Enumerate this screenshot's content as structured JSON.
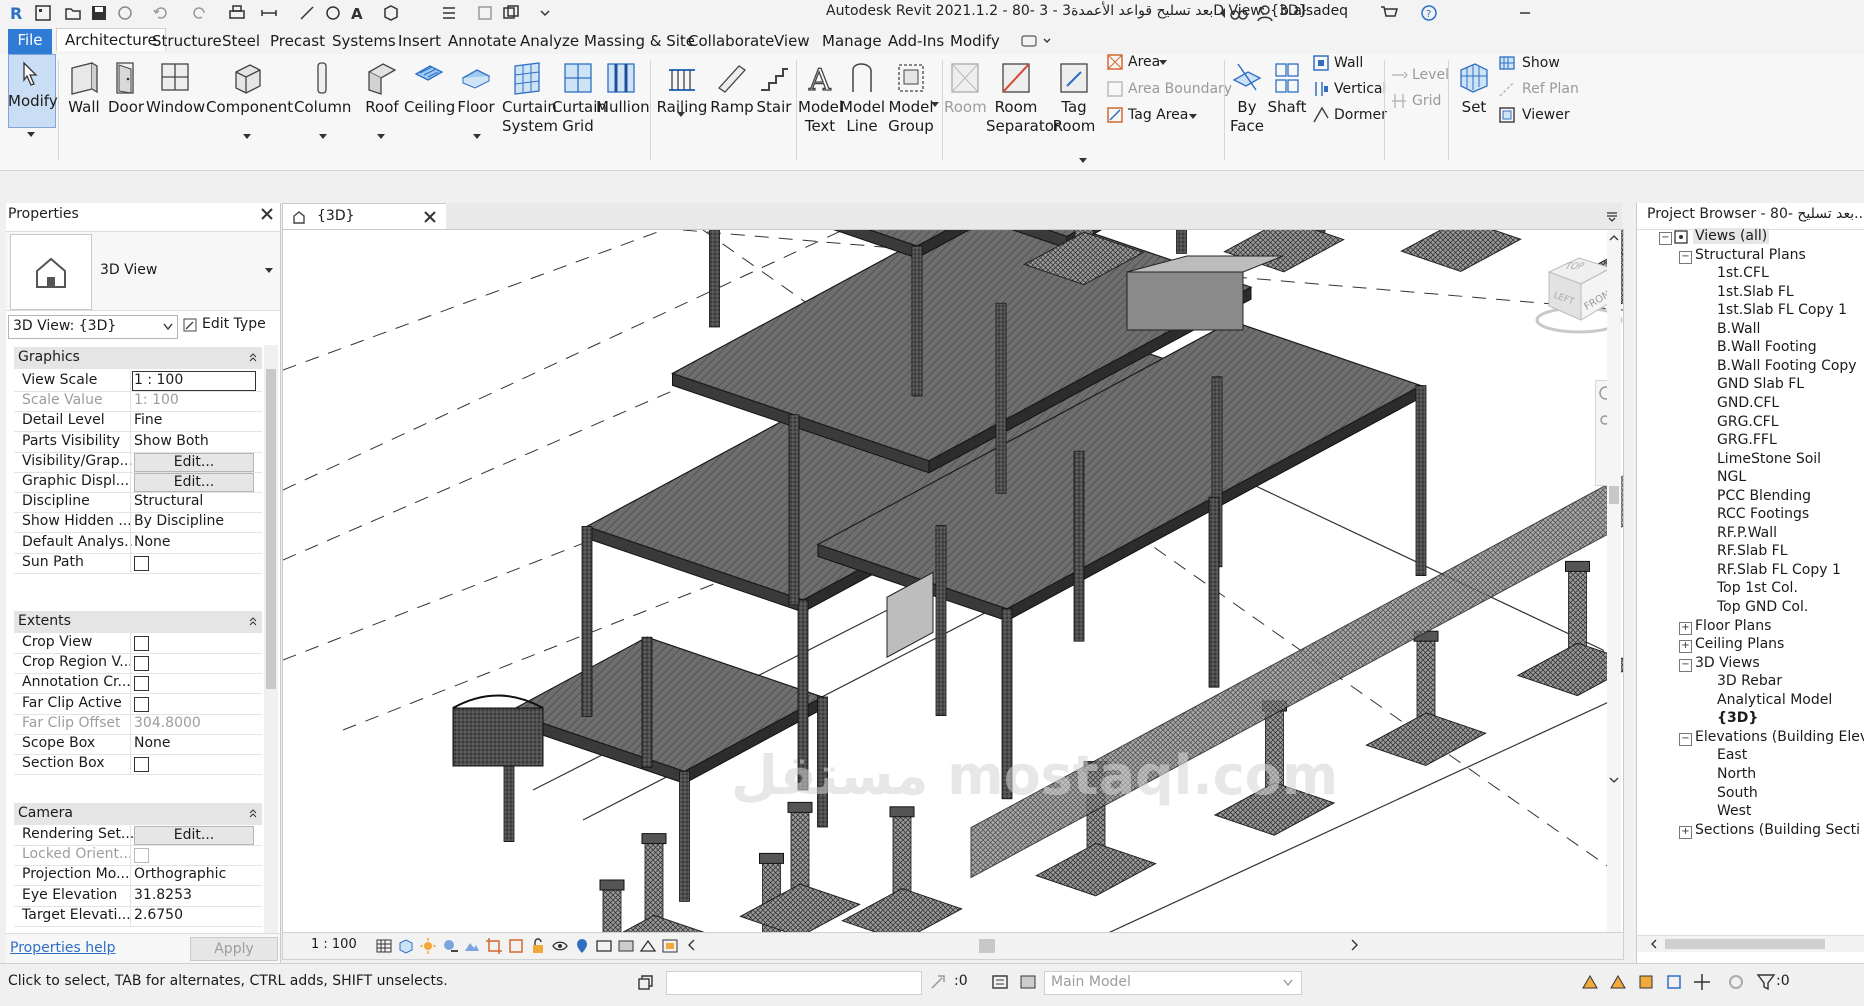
{
  "app": {
    "title": "Autodesk Revit 2021.1.2 - 80- 3 - بعد تسليح قواعد الأعمدة3D View: {3D}",
    "user": "b.alsadeq"
  },
  "ribbon_tabs": [
    "File",
    "Architecture",
    "Structure",
    "Steel",
    "Precast",
    "Systems",
    "Insert",
    "Annotate",
    "Analyze",
    "Massing & Site",
    "Collaborate",
    "View",
    "Manage",
    "Add-Ins",
    "Modify"
  ],
  "ribbon": {
    "modify": "Modify",
    "wall": "Wall",
    "door": "Door",
    "window": "Window",
    "component": "Component",
    "column": "Column",
    "roof": "Roof",
    "ceiling": "Ceiling",
    "floor": "Floor",
    "curtain_system_1": "Curtain",
    "curtain_system_2": "System",
    "curtain_grid_1": "Curtain",
    "curtain_grid_2": "Grid",
    "mullion": "Mullion",
    "railing": "Railing",
    "ramp": "Ramp",
    "stair": "Stair",
    "model_text_1": "Model",
    "model_text_2": "Text",
    "model_line_1": "Model",
    "model_line_2": "Line",
    "model_group_1": "Model",
    "model_group_2": "Group",
    "room": "Room",
    "room_separator_1": "Room",
    "room_separator_2": "Separator",
    "tag_room_1": "Tag",
    "tag_room_2": "Room",
    "area": "Area",
    "area_boundary": "Area  Boundary",
    "tag_area": "Tag  Area",
    "by_face_1": "By",
    "by_face_2": "Face",
    "shaft": "Shaft",
    "wall_opening": "Wall",
    "vertical": "Vertical",
    "dormer": "Dormer",
    "level": "Level",
    "grid": "Grid",
    "set": "Set",
    "show": "Show",
    "ref_plane": "Ref  Plan",
    "viewer": "Viewer"
  },
  "properties": {
    "title": "Properties",
    "type_name": "3D View",
    "selector": "3D View: {3D}",
    "edit_type": "Edit Type",
    "sections": {
      "graphics": "Graphics",
      "extents": "Extents",
      "camera": "Camera"
    },
    "graphics_rows": [
      {
        "k": "View Scale",
        "v": "1 : 100"
      },
      {
        "k": "Scale Value",
        "v": "1:  100"
      },
      {
        "k": "Detail Level",
        "v": "Fine"
      },
      {
        "k": "Parts Visibility",
        "v": "Show Both"
      },
      {
        "k": "Visibility/Grap...",
        "v": "Edit..."
      },
      {
        "k": "Graphic Displ...",
        "v": "Edit..."
      },
      {
        "k": "Discipline",
        "v": "Structural"
      },
      {
        "k": "Show Hidden ...",
        "v": "By Discipline"
      },
      {
        "k": "Default Analys...",
        "v": "None"
      },
      {
        "k": "Sun Path",
        "v": ""
      }
    ],
    "extents_rows": [
      {
        "k": "Crop View",
        "v": ""
      },
      {
        "k": "Crop Region V...",
        "v": ""
      },
      {
        "k": "Annotation Cr...",
        "v": ""
      },
      {
        "k": "Far Clip Active",
        "v": ""
      },
      {
        "k": "Far Clip Offset",
        "v": "304.8000"
      },
      {
        "k": "Scope Box",
        "v": "None"
      },
      {
        "k": "Section Box",
        "v": ""
      }
    ],
    "camera_rows": [
      {
        "k": "Rendering Set...",
        "v": "Edit..."
      },
      {
        "k": "Locked Orient...",
        "v": ""
      },
      {
        "k": "Projection Mo...",
        "v": "Orthographic"
      },
      {
        "k": "Eye Elevation",
        "v": "31.8253"
      },
      {
        "k": "Target Elevati...",
        "v": "2.6750"
      }
    ],
    "help_link": "Properties help",
    "apply": "Apply"
  },
  "view": {
    "tab_label": "{3D}",
    "scale": "1 : 100",
    "cube_top": "TOP",
    "cube_front": "FRONT",
    "cube_left": "LEFT"
  },
  "browser": {
    "title": "Project Browser - 80- بعد تسليح...",
    "root": "Views (all)",
    "structural_plans": "Structural Plans",
    "plans": [
      "1st.CFL",
      "1st.Slab FL",
      "1st.Slab FL Copy 1",
      "B.Wall",
      "B.Wall Footing",
      "B.Wall Footing Copy",
      "GND Slab FL",
      "GND.CFL",
      "GRG.CFL",
      "GRG.FFL",
      "LimeStone Soil",
      "NGL",
      "PCC Blending",
      "RCC Footings",
      "RF.P.Wall",
      "RF.Slab FL",
      "RF.Slab FL Copy 1",
      "Top 1st Col.",
      "Top GND Col."
    ],
    "floor_plans": "Floor Plans",
    "ceiling_plans": "Ceiling Plans",
    "views_3d": "3D Views",
    "views_3d_items": [
      "3D Rebar",
      "Analytical Model",
      "{3D}"
    ],
    "elevations": "Elevations (Building Elev",
    "elevation_items": [
      "East",
      "North",
      "South",
      "West"
    ],
    "sections": "Sections (Building Secti"
  },
  "status": {
    "message": "Click to select, TAB for alternates, CTRL adds, SHIFT unselects.",
    "count": ":0",
    "model": "Main Model",
    "filter_count": ":0"
  },
  "watermark": "مستقل mostaql.com"
}
